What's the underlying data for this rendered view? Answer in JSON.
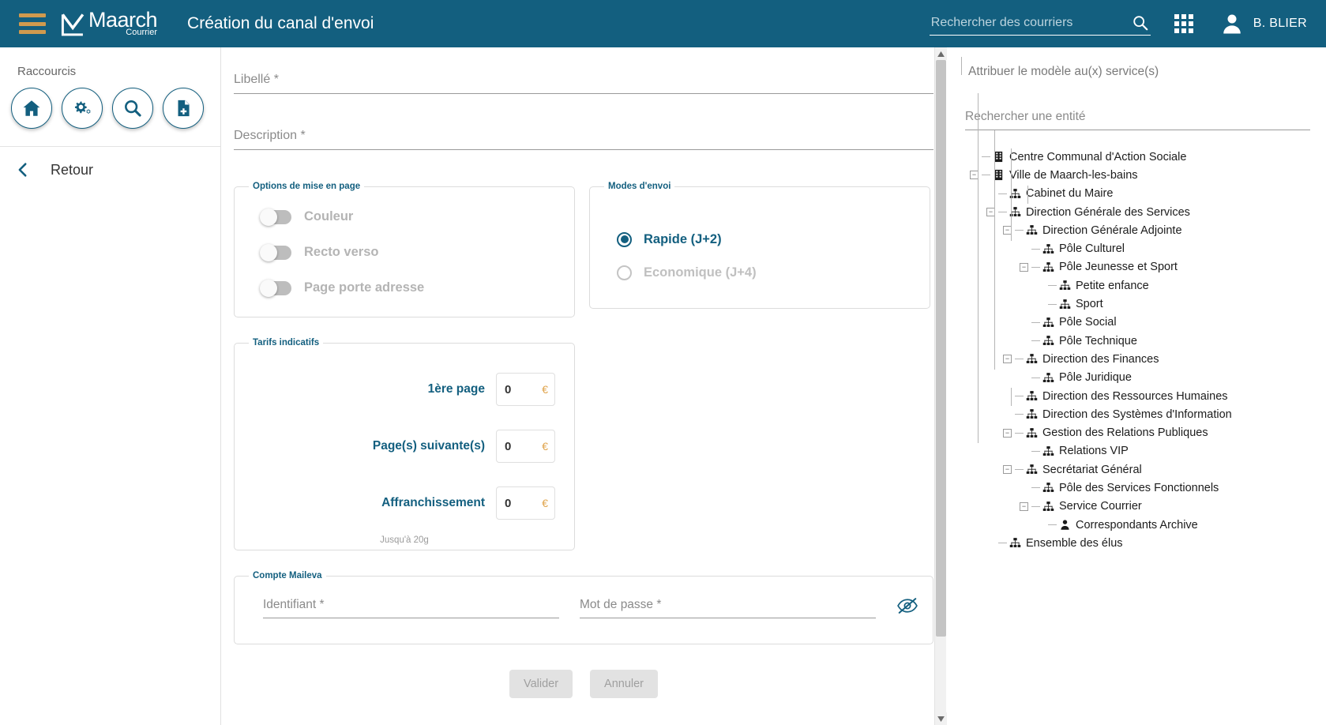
{
  "header": {
    "menu_icon": "hamburger-icon",
    "brand_main": "Maarch",
    "brand_sub": "Courrier",
    "page_title": "Création du canal d'envoi",
    "search_placeholder": "Rechercher des courriers",
    "search_value": "",
    "search_icon": "search-icon",
    "apps_icon": "apps-grid-icon",
    "user_icon": "user-avatar-icon",
    "user_name": "B. BLIER",
    "brand_color": "#135F7F",
    "accent_color": "#D09A4E"
  },
  "sidebar": {
    "shortcuts_label": "Raccourcis",
    "shortcuts": [
      {
        "name": "home-icon",
        "title": "Accueil"
      },
      {
        "name": "gears-icon",
        "title": "Administration"
      },
      {
        "name": "search-icon",
        "title": "Recherche"
      },
      {
        "name": "new-document-icon",
        "title": "Nouveau courrier"
      }
    ],
    "back_label": "Retour",
    "back_icon": "chevron-left-icon"
  },
  "form": {
    "libelle": {
      "placeholder": "Libellé *",
      "value": ""
    },
    "description": {
      "placeholder": "Description *",
      "value": ""
    },
    "layout_options": {
      "legend": "Options de mise en page",
      "toggles": [
        {
          "label": "Couleur",
          "checked": false
        },
        {
          "label": "Recto verso",
          "checked": false
        },
        {
          "label": "Page porte adresse",
          "checked": false
        }
      ]
    },
    "send_modes": {
      "legend": "Modes d'envoi",
      "options": [
        {
          "label": "Rapide (J+2)",
          "checked": true
        },
        {
          "label": "Economique (J+4)",
          "checked": false
        }
      ]
    },
    "tarifs": {
      "legend": "Tarifs indicatifs",
      "currency": "€",
      "rows": [
        {
          "label": "1ère page",
          "value": "0"
        },
        {
          "label": "Page(s) suivante(s)",
          "value": "0"
        },
        {
          "label": "Affranchissement",
          "value": "0"
        }
      ],
      "note": "Jusqu'à 20g"
    },
    "maileva": {
      "legend": "Compte Maileva",
      "identifiant": {
        "placeholder": "Identifiant *",
        "value": ""
      },
      "password": {
        "placeholder": "Mot de passe *",
        "value": ""
      },
      "toggle_visibility_icon": "eye-slash-icon"
    },
    "buttons": {
      "validate": "Valider",
      "cancel": "Annuler"
    }
  },
  "entities_panel": {
    "title": "Attribuer le modèle au(x) service(s)",
    "search_placeholder": "Rechercher une entité",
    "search_value": "",
    "tree": [
      {
        "label": "Centre Communal d'Action Sociale",
        "depth": 0,
        "icon": "building-icon",
        "expander": "none"
      },
      {
        "label": "Ville de Maarch-les-bains",
        "depth": 0,
        "icon": "building-icon",
        "expander": "minus"
      },
      {
        "label": "Cabinet du Maire",
        "depth": 1,
        "icon": "org-chart-icon",
        "expander": "none"
      },
      {
        "label": "Direction Générale des Services",
        "depth": 1,
        "icon": "org-chart-icon",
        "expander": "minus"
      },
      {
        "label": "Direction Générale Adjointe",
        "depth": 2,
        "icon": "org-chart-icon",
        "expander": "minus"
      },
      {
        "label": "Pôle Culturel",
        "depth": 3,
        "icon": "org-chart-icon",
        "expander": "none"
      },
      {
        "label": "Pôle Jeunesse et Sport",
        "depth": 3,
        "icon": "org-chart-icon",
        "expander": "minus"
      },
      {
        "label": "Petite enfance",
        "depth": 4,
        "icon": "org-chart-icon",
        "expander": "none"
      },
      {
        "label": "Sport",
        "depth": 4,
        "icon": "org-chart-icon",
        "expander": "none"
      },
      {
        "label": "Pôle Social",
        "depth": 3,
        "icon": "org-chart-icon",
        "expander": "none"
      },
      {
        "label": "Pôle Technique",
        "depth": 3,
        "icon": "org-chart-icon",
        "expander": "none"
      },
      {
        "label": "Direction des Finances",
        "depth": 2,
        "icon": "org-chart-icon",
        "expander": "minus"
      },
      {
        "label": "Pôle Juridique",
        "depth": 3,
        "icon": "org-chart-icon",
        "expander": "none"
      },
      {
        "label": "Direction des Ressources Humaines",
        "depth": 2,
        "icon": "org-chart-icon",
        "expander": "none"
      },
      {
        "label": "Direction des Systèmes d'Information",
        "depth": 2,
        "icon": "org-chart-icon",
        "expander": "none"
      },
      {
        "label": "Gestion des Relations Publiques",
        "depth": 2,
        "icon": "org-chart-icon",
        "expander": "minus"
      },
      {
        "label": "Relations VIP",
        "depth": 3,
        "icon": "org-chart-icon",
        "expander": "none"
      },
      {
        "label": "Secrétariat Général",
        "depth": 2,
        "icon": "org-chart-icon",
        "expander": "minus"
      },
      {
        "label": "Pôle des Services Fonctionnels",
        "depth": 3,
        "icon": "org-chart-icon",
        "expander": "none"
      },
      {
        "label": "Service Courrier",
        "depth": 3,
        "icon": "org-chart-icon",
        "expander": "minus"
      },
      {
        "label": "Correspondants Archive",
        "depth": 4,
        "icon": "user-icon",
        "expander": "none"
      },
      {
        "label": "Ensemble des élus",
        "depth": 1,
        "icon": "org-chart-icon",
        "expander": "none"
      }
    ]
  }
}
